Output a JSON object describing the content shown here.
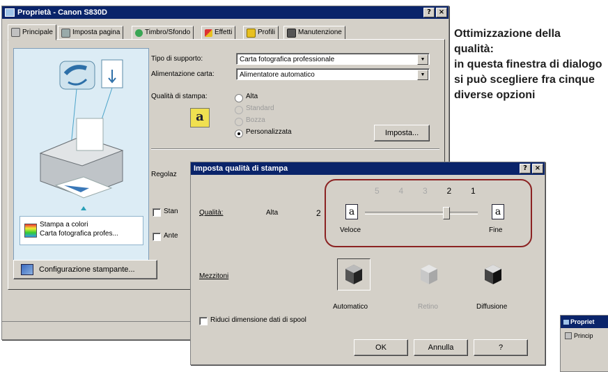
{
  "main_dialog": {
    "title": "Proprietà - Canon S830D",
    "help_btn": "?",
    "close_btn": "×",
    "tabs": [
      {
        "label": "Principale",
        "icon": "printer-tab-icon"
      },
      {
        "label": "Imposta pagina",
        "icon": "page-setup-icon"
      },
      {
        "label": "Timbro/Sfondo",
        "icon": "stamp-icon"
      },
      {
        "label": "Effetti",
        "icon": "effects-brush-icon"
      },
      {
        "label": "Profili",
        "icon": "profiles-icon"
      },
      {
        "label": "Manutenzione",
        "icon": "maintenance-icon"
      }
    ],
    "media_type_label": "Tipo di supporto:",
    "media_type_value": "Carta fotografica professionale",
    "paper_source_label": "Alimentazione carta:",
    "paper_source_value": "Alimentatore automatico",
    "print_quality_label": "Qualità di stampa:",
    "quality_options": [
      "Alta",
      "Standard",
      "Bozza",
      "Personalizzata"
    ],
    "quality_selected": "Personalizzata",
    "set_button": "Imposta...",
    "color_adjust_label_partial": "Regolaz",
    "check1_partial": "Stan",
    "check2_partial": "Ante",
    "summary_line1": "Stampa a colori",
    "summary_line2": "Carta fotografica profes...",
    "config_button": "Configurazione stampante..."
  },
  "quality_dialog": {
    "title": "Imposta qualità di stampa",
    "help_btn": "?",
    "close_btn": "×",
    "quality_label": "Qualità:",
    "quality_text": "Alta",
    "quality_number": "2",
    "slider_ticks": [
      "5",
      "4",
      "3",
      "2",
      "1"
    ],
    "slider_value": 2,
    "slider_left_label": "Veloce",
    "slider_right_label": "Fine",
    "halftone_label": "Mezzitoni",
    "halftone_options": [
      "Automatico",
      "Retino",
      "Diffusione"
    ],
    "reduce_spool_label": "Riduci dimensione dati di spool",
    "ok_button": "OK",
    "cancel_button": "Annulla",
    "help_button": "?"
  },
  "caption": {
    "heading": "Ottimizzazione della qualità:",
    "body": "in questa finestra di dialogo si può scegliere fra cinque diverse opzioni"
  },
  "thumb_dialog": {
    "title": "Propriet",
    "tab": "Princip"
  },
  "colors": {
    "highlight_ring": "#8b2222",
    "caption_text": "#1e1e1e",
    "titlebar": "#0a246a"
  }
}
